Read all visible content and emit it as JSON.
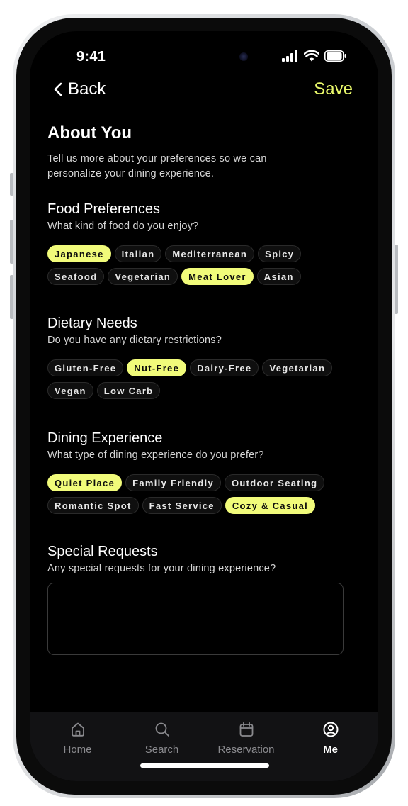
{
  "status": {
    "time": "9:41"
  },
  "nav": {
    "back_label": "Back",
    "save_label": "Save"
  },
  "intro": {
    "title": "About You",
    "subtitle_line1": "Tell us more about your preferences so we can",
    "subtitle_line2": "personalize your dining experience."
  },
  "food": {
    "title": "Food Preferences",
    "subtitle": "What kind of food do you enjoy?",
    "chips": [
      {
        "label": "Japanese",
        "selected": true
      },
      {
        "label": "Italian",
        "selected": false
      },
      {
        "label": "Mediterranean",
        "selected": false
      },
      {
        "label": "Spicy",
        "selected": false
      },
      {
        "label": "Seafood",
        "selected": false
      },
      {
        "label": "Vegetarian",
        "selected": false
      },
      {
        "label": "Meat Lover",
        "selected": true
      },
      {
        "label": "Asian",
        "selected": false
      }
    ]
  },
  "dietary": {
    "title": "Dietary Needs",
    "subtitle": "Do you have any dietary restrictions?",
    "chips": [
      {
        "label": "Gluten-Free",
        "selected": false
      },
      {
        "label": "Nut-Free",
        "selected": true
      },
      {
        "label": "Dairy-Free",
        "selected": false
      },
      {
        "label": "Vegetarian",
        "selected": false
      },
      {
        "label": "Vegan",
        "selected": false
      },
      {
        "label": "Low Carb",
        "selected": false
      }
    ]
  },
  "dining": {
    "title": "Dining Experience",
    "subtitle": "What type of dining experience do you prefer?",
    "chips": [
      {
        "label": "Quiet Place",
        "selected": true
      },
      {
        "label": "Family Friendly",
        "selected": false
      },
      {
        "label": "Outdoor Seating",
        "selected": false
      },
      {
        "label": "Romantic Spot",
        "selected": false
      },
      {
        "label": "Fast Service",
        "selected": false
      },
      {
        "label": "Cozy & Casual",
        "selected": true
      }
    ]
  },
  "special": {
    "title": "Special Requests",
    "subtitle": "Any special requests for your dining experience?",
    "value": ""
  },
  "tabs": [
    {
      "label": "Home",
      "icon": "home-icon",
      "active": false
    },
    {
      "label": "Search",
      "icon": "search-icon",
      "active": false
    },
    {
      "label": "Reservation",
      "icon": "calendar-icon",
      "active": false
    },
    {
      "label": "Me",
      "icon": "user-circle-icon",
      "active": true
    }
  ],
  "colors": {
    "accent": "#F1FB7A",
    "save_text": "#E9F86A",
    "background": "#000000",
    "tabbar": "#121214"
  }
}
